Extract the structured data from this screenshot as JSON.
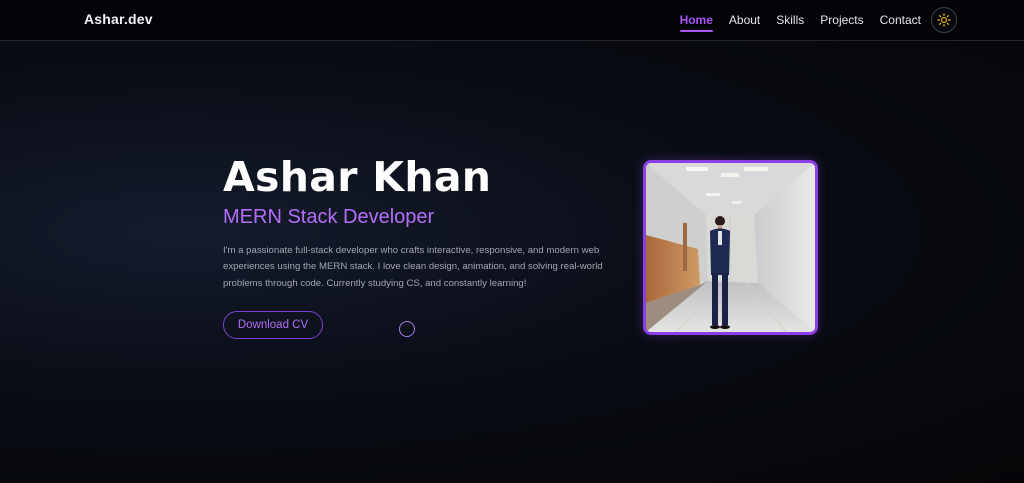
{
  "nav": {
    "brand": "Ashar.dev",
    "links": [
      {
        "label": "Home",
        "active": true
      },
      {
        "label": "About",
        "active": false
      },
      {
        "label": "Skills",
        "active": false
      },
      {
        "label": "Projects",
        "active": false
      },
      {
        "label": "Contact",
        "active": false
      }
    ],
    "theme_toggle_icon": "sun-icon"
  },
  "hero": {
    "name": "Ashar Khan",
    "role": "MERN Stack Developer",
    "description": "I'm a passionate full-stack developer who crafts interactive, responsive, and modern web experiences using the MERN stack. I love clean design, animation, and solving real-world problems through code. Currently studying CS, and constantly learning!",
    "cv_button_label": "Download CV"
  },
  "colors": {
    "accent": "#a855f7",
    "accent_light": "#b36ef8",
    "background": "#0a0d15",
    "sun": "#f5b33c"
  }
}
